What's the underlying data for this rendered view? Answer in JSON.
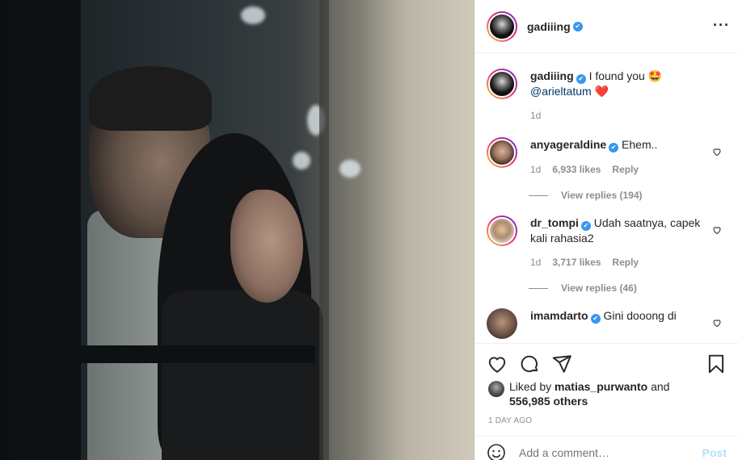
{
  "post": {
    "author": "gadiiing",
    "verified_mark": "✔",
    "more_icon": "more-horizontal-icon",
    "caption": {
      "text_before": "I found you",
      "emoji1": "🤩",
      "mention": "@arieltatum",
      "emoji2": "❤️",
      "time": "1d"
    },
    "comments": [
      {
        "user": "anyageraldine",
        "text": "Ehem..",
        "time": "1d",
        "likes": "6,933 likes",
        "reply_label": "Reply",
        "view_replies": "View replies (194)"
      },
      {
        "user": "dr_tompi",
        "text": "Udah saatnya, capek kali rahasia2",
        "time": "1d",
        "likes": "3,717 likes",
        "reply_label": "Reply",
        "view_replies": "View replies (46)"
      },
      {
        "user": "imamdarto",
        "text": "Gini dooong di"
      }
    ],
    "liked_by": {
      "prefix": "Liked by",
      "user": "matias_purwanto",
      "and": "and",
      "others": "556,985 others"
    },
    "timestamp": "1 DAY AGO",
    "add_comment": {
      "placeholder": "Add a comment…",
      "post_label": "Post"
    }
  },
  "colors": {
    "verified": "#3897f0",
    "heart": "#ed4956",
    "link": "#00376b",
    "post_disabled": "#b2dffc",
    "muted": "#8e8e8e"
  }
}
